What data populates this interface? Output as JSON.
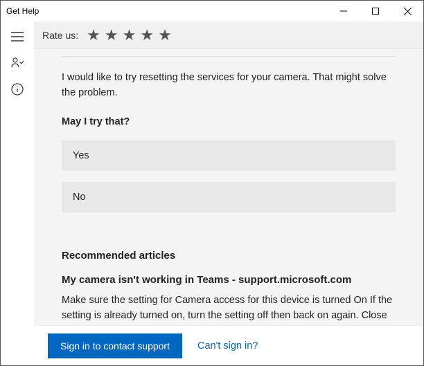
{
  "window": {
    "title": "Get Help"
  },
  "rate": {
    "label": "Rate us:"
  },
  "chat": {
    "message": "I would like to try resetting the services for your camera. That might solve the problem.",
    "question": "May I try that?",
    "options": {
      "yes": "Yes",
      "no": "No"
    }
  },
  "recommended": {
    "heading": "Recommended articles",
    "article": {
      "title": "My camera isn't working in Teams - support.microsoft.com",
      "snippet": "Make sure the setting for Camera access for this device is turned On If the setting is already turned on, turn the setting off then back on again. Close all apps and restart your device. Check your drivers. When your camera"
    }
  },
  "footer": {
    "signin": "Sign in to contact support",
    "cant": "Can't sign in?"
  }
}
